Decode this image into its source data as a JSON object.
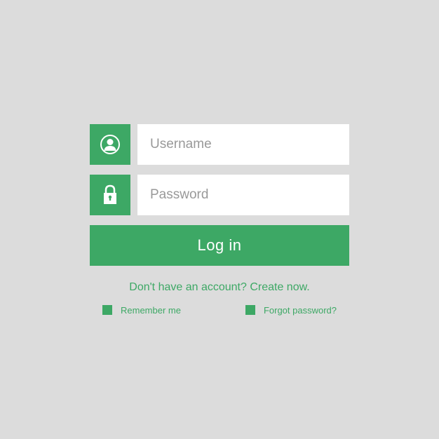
{
  "form": {
    "username": {
      "placeholder": "Username",
      "value": ""
    },
    "password": {
      "placeholder": "Password",
      "value": ""
    },
    "login_button_label": "Log in",
    "create_account_text": "Don't have an account? Create now.",
    "remember_me_label": "Remember me",
    "forgot_password_label": "Forgot password?"
  },
  "colors": {
    "primary": "#3da865",
    "background": "#dcdcdc",
    "input_bg": "#ffffff"
  }
}
